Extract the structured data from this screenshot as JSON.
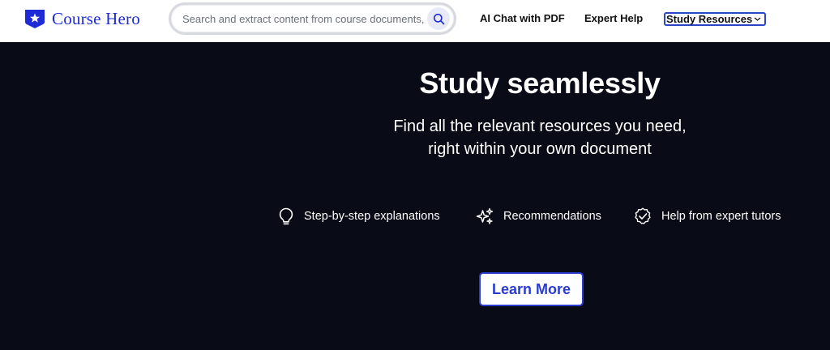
{
  "brand": {
    "name": "Course Hero",
    "icon": "star-shield-icon",
    "color": "#1f2bd6"
  },
  "search": {
    "placeholder": "Search and extract content from course documents, ...",
    "icon": "search-icon"
  },
  "nav": {
    "ai_chat": "AI Chat with PDF",
    "expert_help": "Expert Help",
    "study_resources": "Study Resources",
    "dropdown_icon": "chevron-down-icon"
  },
  "hero": {
    "title": "Study seamlessly",
    "subtitle_line1": "Find all the relevant resources you need,",
    "subtitle_line2": "right within your own document",
    "background": "#090b16",
    "features": [
      {
        "icon": "lightbulb-icon",
        "label": "Step-by-step explanations"
      },
      {
        "icon": "sparkles-icon",
        "label": "Recommendations"
      },
      {
        "icon": "check-badge-icon",
        "label": "Help from expert tutors"
      }
    ],
    "cta_label": "Learn More",
    "accent": "#2a3bd0"
  }
}
